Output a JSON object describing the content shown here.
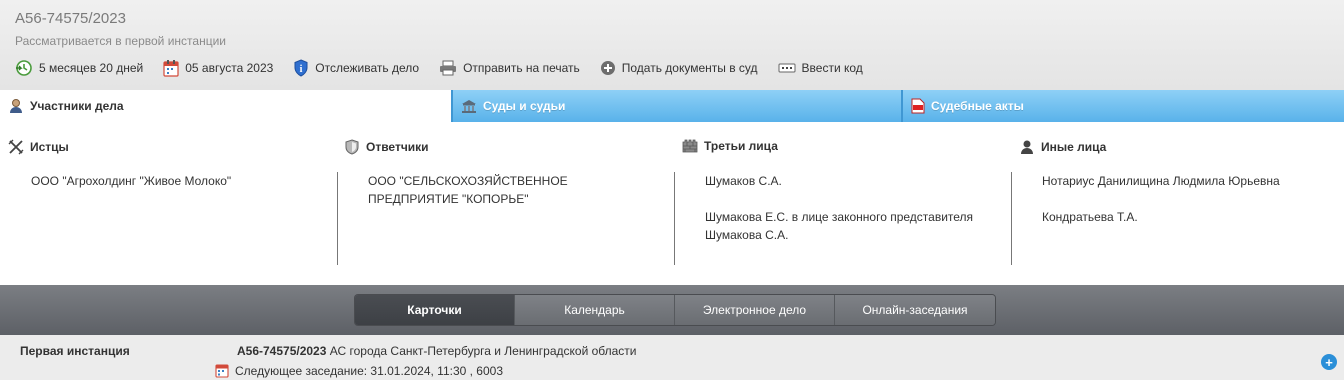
{
  "header": {
    "case_number": "А56-74575/2023",
    "status": "Рассматривается в первой инстанции",
    "actions": [
      {
        "label": "5 месяцев 20 дней",
        "icon": "clock-back-icon"
      },
      {
        "label": "05 августа 2023",
        "icon": "calendar-icon"
      },
      {
        "label": "Отслеживать дело",
        "icon": "info-shield-icon"
      },
      {
        "label": "Отправить на печать",
        "icon": "printer-icon"
      },
      {
        "label": "Подать документы в суд",
        "icon": "plus-circle-icon"
      },
      {
        "label": "Ввести код",
        "icon": "code-icon"
      }
    ]
  },
  "tabs": [
    {
      "label": "Участники дела",
      "icon": "person-icon",
      "active": true
    },
    {
      "label": "Суды и судьи",
      "icon": "court-building-icon",
      "active": false
    },
    {
      "label": "Судебные акты",
      "icon": "pdf-icon",
      "active": false
    }
  ],
  "participants": {
    "plaintiffs": {
      "title": "Истцы",
      "items": [
        "ООО \"Агрохолдинг \"Живое Молоко\""
      ]
    },
    "defendants": {
      "title": "Ответчики",
      "items": [
        "ООО \"СЕЛЬСКОХОЗЯЙСТВЕННОЕ ПРЕДПРИЯТИЕ \"КОПОРЬЕ\""
      ]
    },
    "third_parties": {
      "title": "Третьи лица",
      "items": [
        "Шумаков С.А.",
        "Шумакова Е.С. в лице законного представителя Шумакова С.А."
      ]
    },
    "others": {
      "title": "Иные лица",
      "items": [
        "Нотариус Данилищина Людмила Юрьевна",
        "Кондратьева Т.А."
      ]
    }
  },
  "view_tabs": [
    {
      "label": "Карточки",
      "active": true
    },
    {
      "label": "Календарь",
      "active": false
    },
    {
      "label": "Электронное дело",
      "active": false
    },
    {
      "label": "Онлайн-заседания",
      "active": false
    }
  ],
  "instance": {
    "label": "Первая инстанция",
    "case_number": "А56-74575/2023",
    "court": "АС города Санкт-Петербурга и Ленинградской области",
    "next_hearing": "Следующее заседание: 31.01.2024, 11:30 , 6003",
    "expand_label": "+"
  },
  "colors": {
    "tab_blue": "#59b2ea",
    "dark_bar": "#5d6066",
    "accent": "#2b8fd8"
  }
}
